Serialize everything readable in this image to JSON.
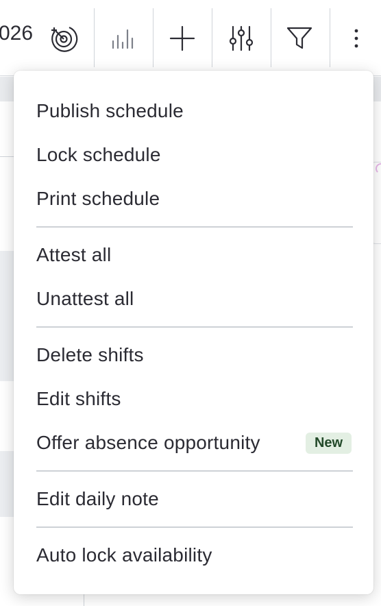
{
  "toolbar": {
    "date_fragment": "026",
    "buttons": [
      {
        "icon": "target-clock-icon"
      },
      {
        "icon": "bar-chart-icon"
      },
      {
        "icon": "plus-icon"
      },
      {
        "icon": "sliders-icon"
      },
      {
        "icon": "filter-icon"
      },
      {
        "icon": "more-vertical-icon"
      }
    ]
  },
  "menu": {
    "groups": [
      [
        "Publish schedule",
        "Lock schedule",
        "Print schedule"
      ],
      [
        "Attest all",
        "Unattest all"
      ],
      [
        "Delete shifts",
        "Edit shifts",
        "Offer absence opportunity"
      ],
      [
        "Edit daily note"
      ],
      [
        "Auto lock availability"
      ]
    ],
    "badge_new": "New"
  },
  "colors": {
    "text": "#2b2b33",
    "divider": "#cdd1d6",
    "badge_bg": "#e3efe3",
    "badge_text": "#234a2a"
  }
}
